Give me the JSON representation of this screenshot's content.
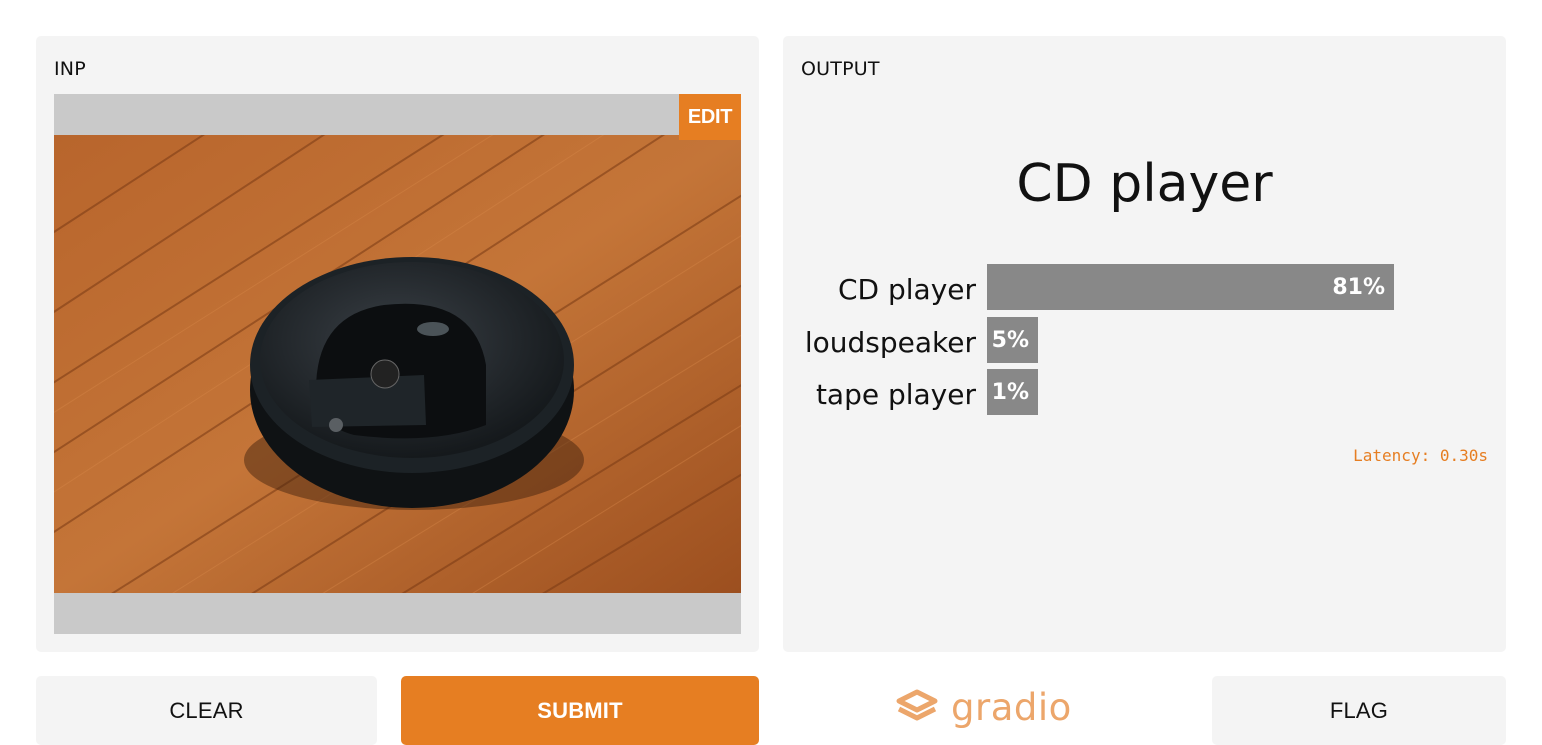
{
  "input_panel": {
    "title": "INP",
    "edit_label": "EDIT"
  },
  "output_panel": {
    "title": "OUTPUT",
    "label": "CD player",
    "confidences": [
      {
        "name": "CD player",
        "value": 0.81,
        "text": "81%"
      },
      {
        "name": "loudspeaker",
        "value": 0.05,
        "text": "5%"
      },
      {
        "name": "tape player",
        "value": 0.01,
        "text": "1%"
      }
    ],
    "latency": "Latency: 0.30s"
  },
  "buttons": {
    "clear": "CLEAR",
    "submit": "SUBMIT",
    "flag": "FLAG"
  },
  "logo": {
    "text": "gradio"
  },
  "colors": {
    "accent": "#e67e22",
    "bar": "#888888",
    "panel": "#f4f4f4"
  },
  "icons": {
    "logo_icon": "gradio-logo-icon"
  }
}
